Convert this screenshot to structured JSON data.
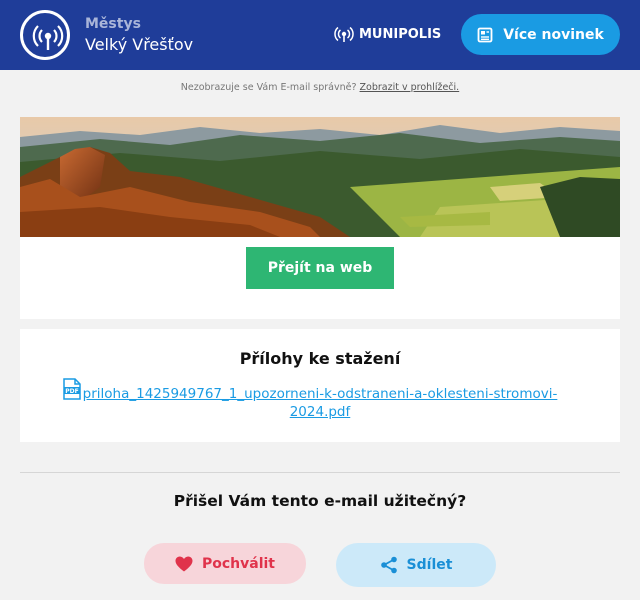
{
  "header": {
    "town_type": "Městys",
    "town_name": "Velký Vřešťov",
    "brand": "MUNIPOLIS",
    "more_news_button": "Více novinek",
    "colors": {
      "background": "#1f3d99",
      "button": "#1a9be3"
    },
    "icons": {
      "logo": "broadcast-antenna-icon",
      "brand": "broadcast-icon",
      "more_news": "newspaper-icon"
    }
  },
  "notice": {
    "text": "Nezobrazuje se Vám E-mail správně?",
    "link": "Zobrazit v prohlížeči."
  },
  "hero": {
    "image_subject": "landscape-valley-photo",
    "web_button": "Přejít na web",
    "button_color": "#2eb673"
  },
  "attachments": {
    "title": "Přílohy ke stažení",
    "file_icon": "pdf-file-icon",
    "files": [
      {
        "name": "priloha_1425949767_1_upozorneni-k-odstraneni-a-oklesteni-stromovi-2024.pdf"
      }
    ]
  },
  "feedback": {
    "question": "Přišel Vám tento e-mail užitečný?",
    "praise_button": "Pochválit",
    "share_button": "Sdílet",
    "icons": {
      "praise": "heart-icon",
      "share": "share-icon"
    },
    "colors": {
      "praise": "#e0334b",
      "share": "#1a8fd6"
    }
  }
}
